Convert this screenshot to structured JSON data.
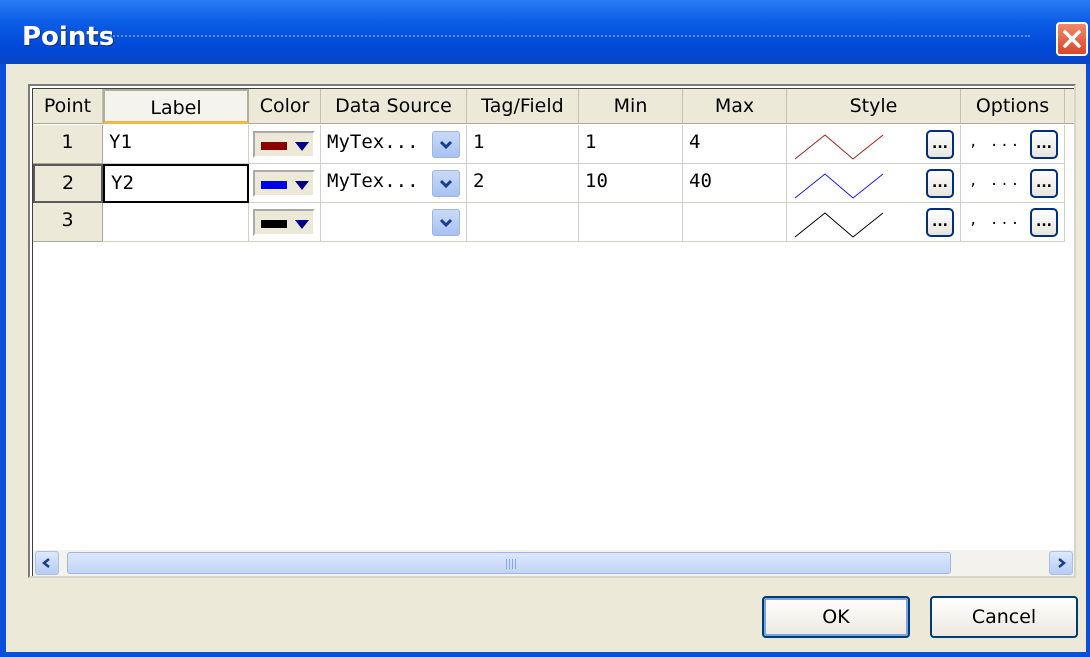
{
  "window": {
    "title": "Points"
  },
  "columns": [
    "Point",
    "Label",
    "Color",
    "Data Source",
    "Tag/Field",
    "Min",
    "Max",
    "Style",
    "Options"
  ],
  "rows": [
    {
      "point": "1",
      "label": "Y1",
      "color": "#8b0000",
      "data_source": "MyTex...",
      "tag_field": "1",
      "min": "1",
      "max": "4",
      "options": ", ...",
      "style_color": "#a02020"
    },
    {
      "point": "2",
      "label": "Y2",
      "color": "#0000ee",
      "data_source": "MyTex...",
      "tag_field": "2",
      "min": "10",
      "max": "40",
      "options": ", ...",
      "style_color": "#1a1af0"
    },
    {
      "point": "3",
      "label": "",
      "color": "#000000",
      "data_source": "",
      "tag_field": "",
      "min": "",
      "max": "",
      "options": ", ...",
      "style_color": "#000000"
    }
  ],
  "buttons": {
    "ok": "OK",
    "cancel": "Cancel",
    "ellipsis": "..."
  }
}
